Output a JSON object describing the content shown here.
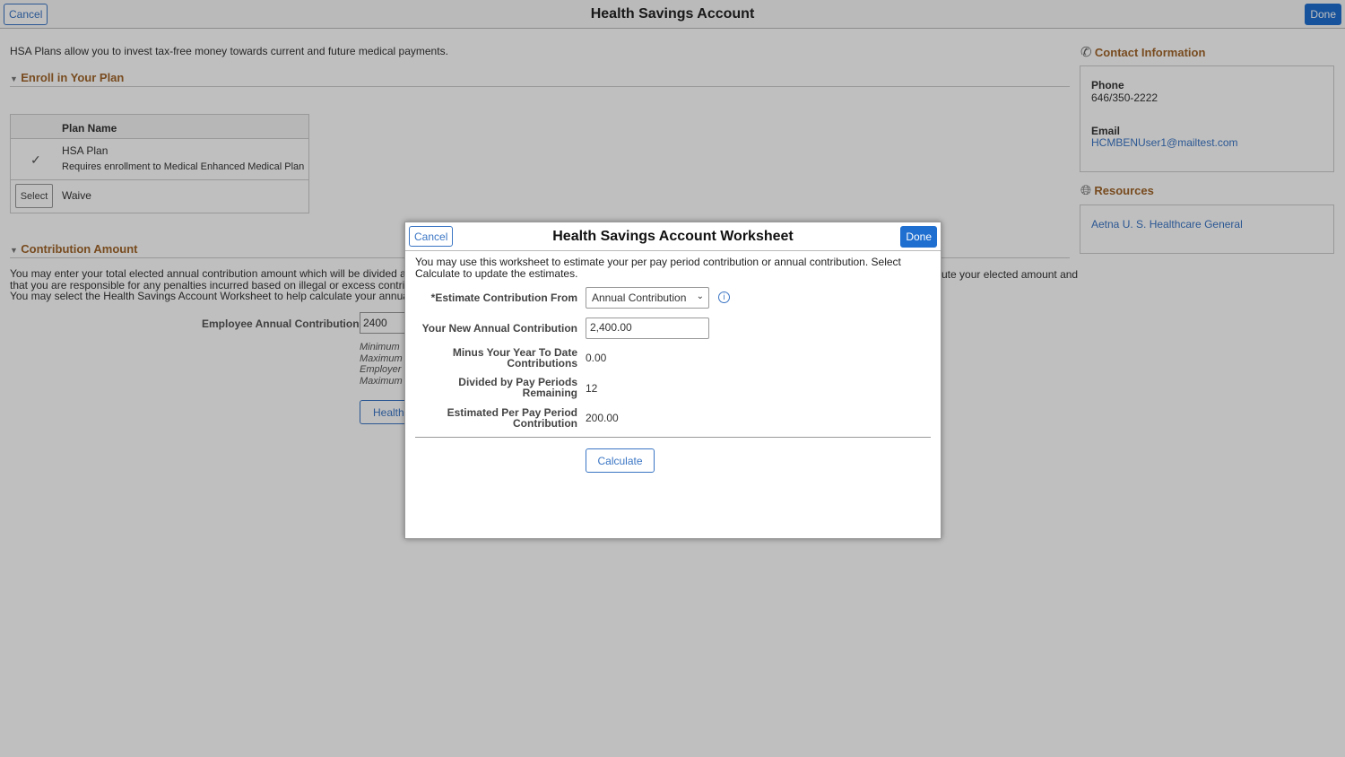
{
  "header": {
    "title": "Health Savings Account",
    "cancel": "Cancel",
    "done": "Done"
  },
  "intro": "HSA Plans allow you to invest tax-free money towards current and future medical payments.",
  "enroll": {
    "title": "Enroll in Your Plan",
    "col_header": "Plan Name",
    "plan_name": "HSA Plan",
    "plan_note": "Requires enrollment to Medical Enhanced Medical Plan",
    "select_label": "Select",
    "waive": "Waive"
  },
  "contribution": {
    "title": "Contribution Amount",
    "line1_left": "You may enter your total elected annual contribution amount which will be divided and",
    "line1_right": "ute your elected amount and",
    "line2": "that you are responsible for any penalties incurred based on illegal or excess contributi",
    "line3": "You may select the Health Savings Account Worksheet to help calculate your annual co",
    "field_label": "Employee Annual Contribution",
    "field_value": "2400",
    "notes": [
      "Minimum",
      "Maximum",
      "Employer",
      "Maximum"
    ],
    "worksheet_button": "Health"
  },
  "contact": {
    "title": "Contact Information",
    "phone_label": "Phone",
    "phone": "646/350-2222",
    "email_label": "Email",
    "email": "HCMBENUser1@mailtest.com"
  },
  "resources": {
    "title": "Resources",
    "link": "Aetna U. S. Healthcare General"
  },
  "modal": {
    "title": "Health Savings Account Worksheet",
    "cancel": "Cancel",
    "done": "Done",
    "description": "You may use this worksheet to estimate your per pay period contribution or annual contribution. Select Calculate to update the estimates.",
    "estimate_from_label": "*Estimate Contribution From",
    "estimate_from_value": "Annual Contribution",
    "new_annual_label": "Your New Annual Contribution",
    "new_annual_value": "2,400.00",
    "ytd_label1": "Minus Your Year To Date",
    "ytd_label2": "Contributions",
    "ytd_value": "0.00",
    "periods_label1": "Divided by Pay Periods",
    "periods_label2": "Remaining",
    "periods_value": "12",
    "per_period_label1": "Estimated Per Pay Period",
    "per_period_label2": "Contribution",
    "per_period_value": "200.00",
    "calculate": "Calculate"
  }
}
